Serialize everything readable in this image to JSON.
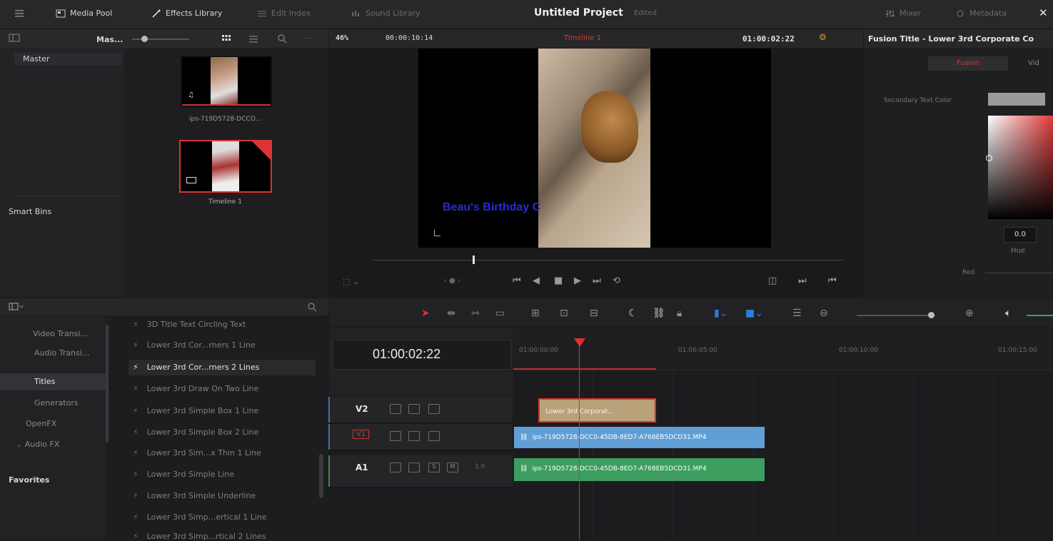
{
  "topbar": {
    "media_pool": "Media Pool",
    "effects_library": "Effects Library",
    "edit_index": "Edit Index",
    "sound_library": "Sound Library",
    "project_title": "Untitled Project",
    "project_status": "Edited",
    "mixer": "Mixer",
    "metadata": "Metadata"
  },
  "media_pool": {
    "bin_path": "Mas...",
    "master_bin": "Master",
    "smart_bins": "Smart Bins",
    "clips": [
      {
        "name": "ips-719D5728-DCCO...",
        "icon": "music-note-icon"
      },
      {
        "name": "Timeline 1",
        "icon": "timeline-icon"
      }
    ]
  },
  "viewer": {
    "zoom": "46%",
    "duration": "00:00:10:14",
    "timeline_name": "Timeline 1",
    "timecode": "01:00:02:22",
    "overlay_text": "Beau's Birthday C"
  },
  "inspector": {
    "title": "Fusion Title - Lower 3rd Corporate Co",
    "tabs": [
      "Fusion",
      "Vid"
    ],
    "secondary_text_color_label": "Secondary Text Color",
    "hue_value": "0.0",
    "hue_label": "Hue",
    "red_label": "Red"
  },
  "effects": {
    "categories": [
      {
        "label": "Video Transi..."
      },
      {
        "label": "Audio Transi..."
      },
      {
        "label": "Titles"
      },
      {
        "label": "Generators"
      },
      {
        "label": "OpenFX"
      },
      {
        "label": "Audio FX"
      },
      {
        "label": "Favorites"
      }
    ],
    "items": [
      {
        "label": "3D Title Text Circling Text"
      },
      {
        "label": "Lower 3rd Cor...rners 1 Line"
      },
      {
        "label": "Lower 3rd Cor...rners 2 Lines"
      },
      {
        "label": "Lower 3rd Draw On Two Line"
      },
      {
        "label": "Lower 3rd Simple Box 1 Line"
      },
      {
        "label": "Lower 3rd Simple Box 2 Line"
      },
      {
        "label": "Lower 3rd Sim...x Thin 1 Line"
      },
      {
        "label": "Lower 3rd Simple Line"
      },
      {
        "label": "Lower 3rd Simple Underline"
      },
      {
        "label": "Lower 3rd Simp...ertical 1 Line"
      },
      {
        "label": "Lower 3rd Simp...rtical 2 Lines"
      }
    ]
  },
  "timeline": {
    "timecode": "01:00:02:22",
    "ruler": [
      "01:00:00:00",
      "01:00:05:00",
      "01:00:10:00",
      "01:00:15:00"
    ],
    "tracks": [
      {
        "name": "V2"
      },
      {
        "name": "V1"
      },
      {
        "name": "A1",
        "level": "1.0",
        "solo": "S",
        "mute": "M"
      }
    ],
    "clips": {
      "title_clip": "Lower 3rd Corporat...",
      "video_clip": "ips-719D5728-DCC0-45DB-8ED7-A768EB5DCD31.MP4",
      "audio_clip": "ips-719D5728-DCC0-45DB-8ED7-A768EB5DCD31.MP4"
    }
  },
  "colors": {
    "accent_red": "#e0322b",
    "video_clip": "#5f9fd6",
    "audio_clip": "#3e9e5f",
    "title_clip": "#b9a17a"
  }
}
